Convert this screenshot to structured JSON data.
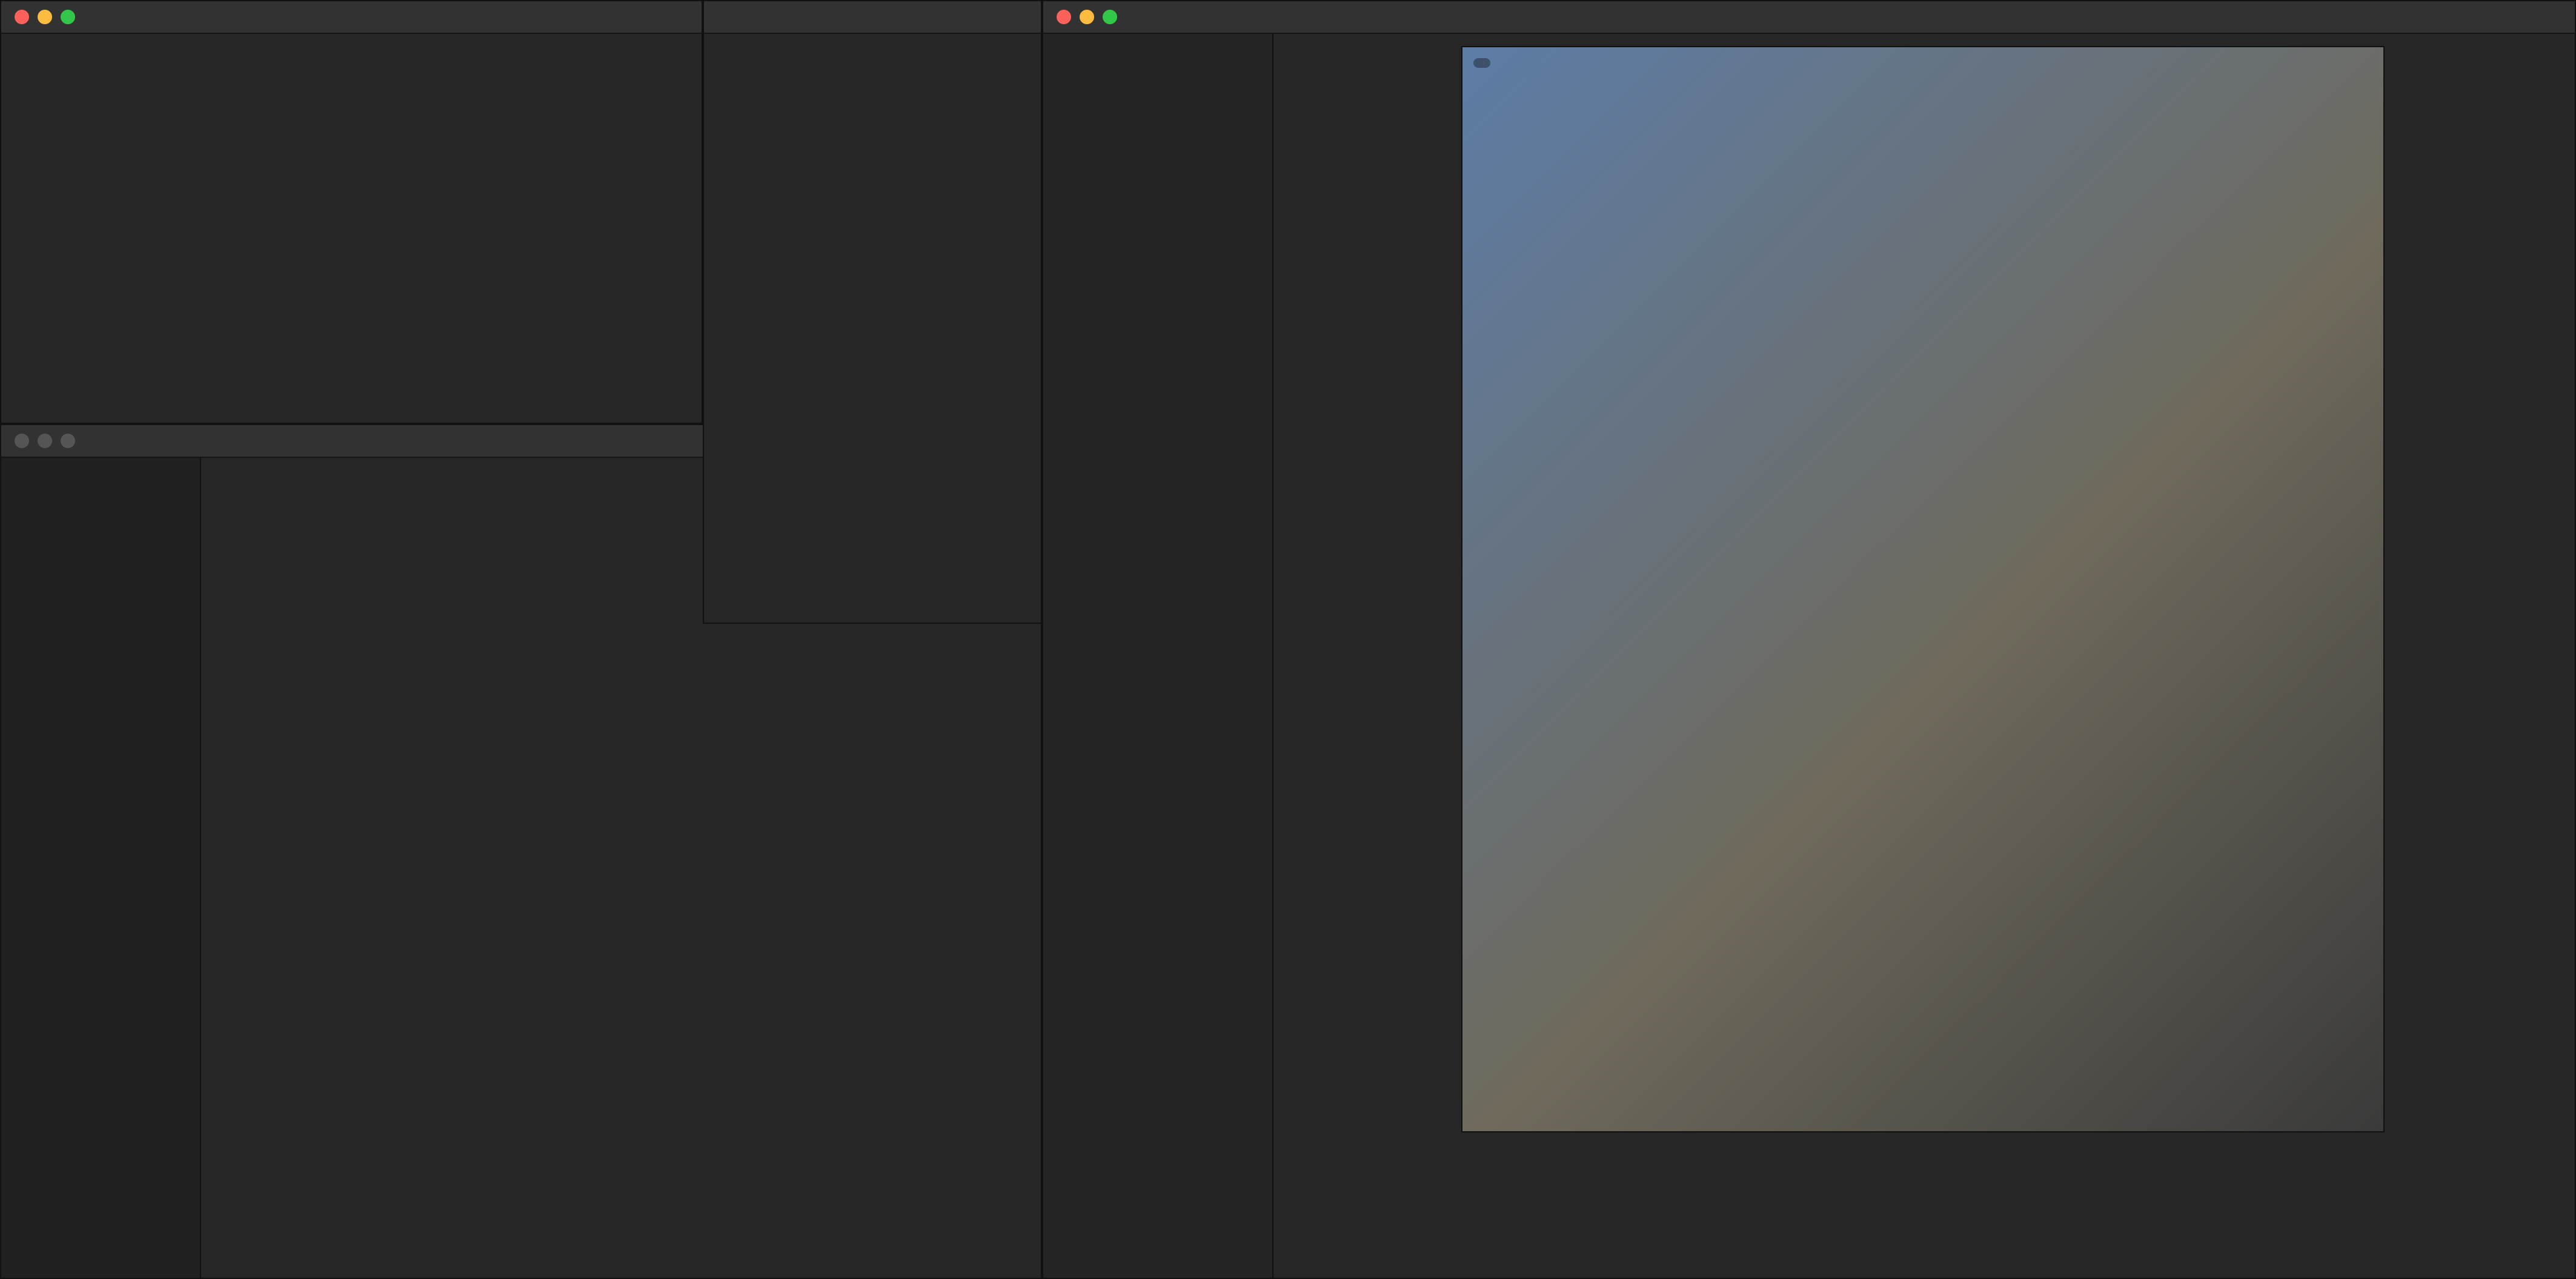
{
  "layout_note": "",
  "left_window": {
    "title": "",
    "tabs": [],
    "heading": "",
    "subtitle": "",
    "details": [],
    "buttons": [],
    "footer": ""
  },
  "system_report": {
    "title": "",
    "sidebar_items": [],
    "selected_item": "",
    "content_lines": [],
    "breadcrumb": ""
  },
  "info_panel": {
    "title": "",
    "fields": [],
    "metadata": []
  },
  "photos_app": {
    "title": "",
    "toolbar_buttons": [],
    "sidebar_sections": [],
    "photo_live_label": ""
  }
}
